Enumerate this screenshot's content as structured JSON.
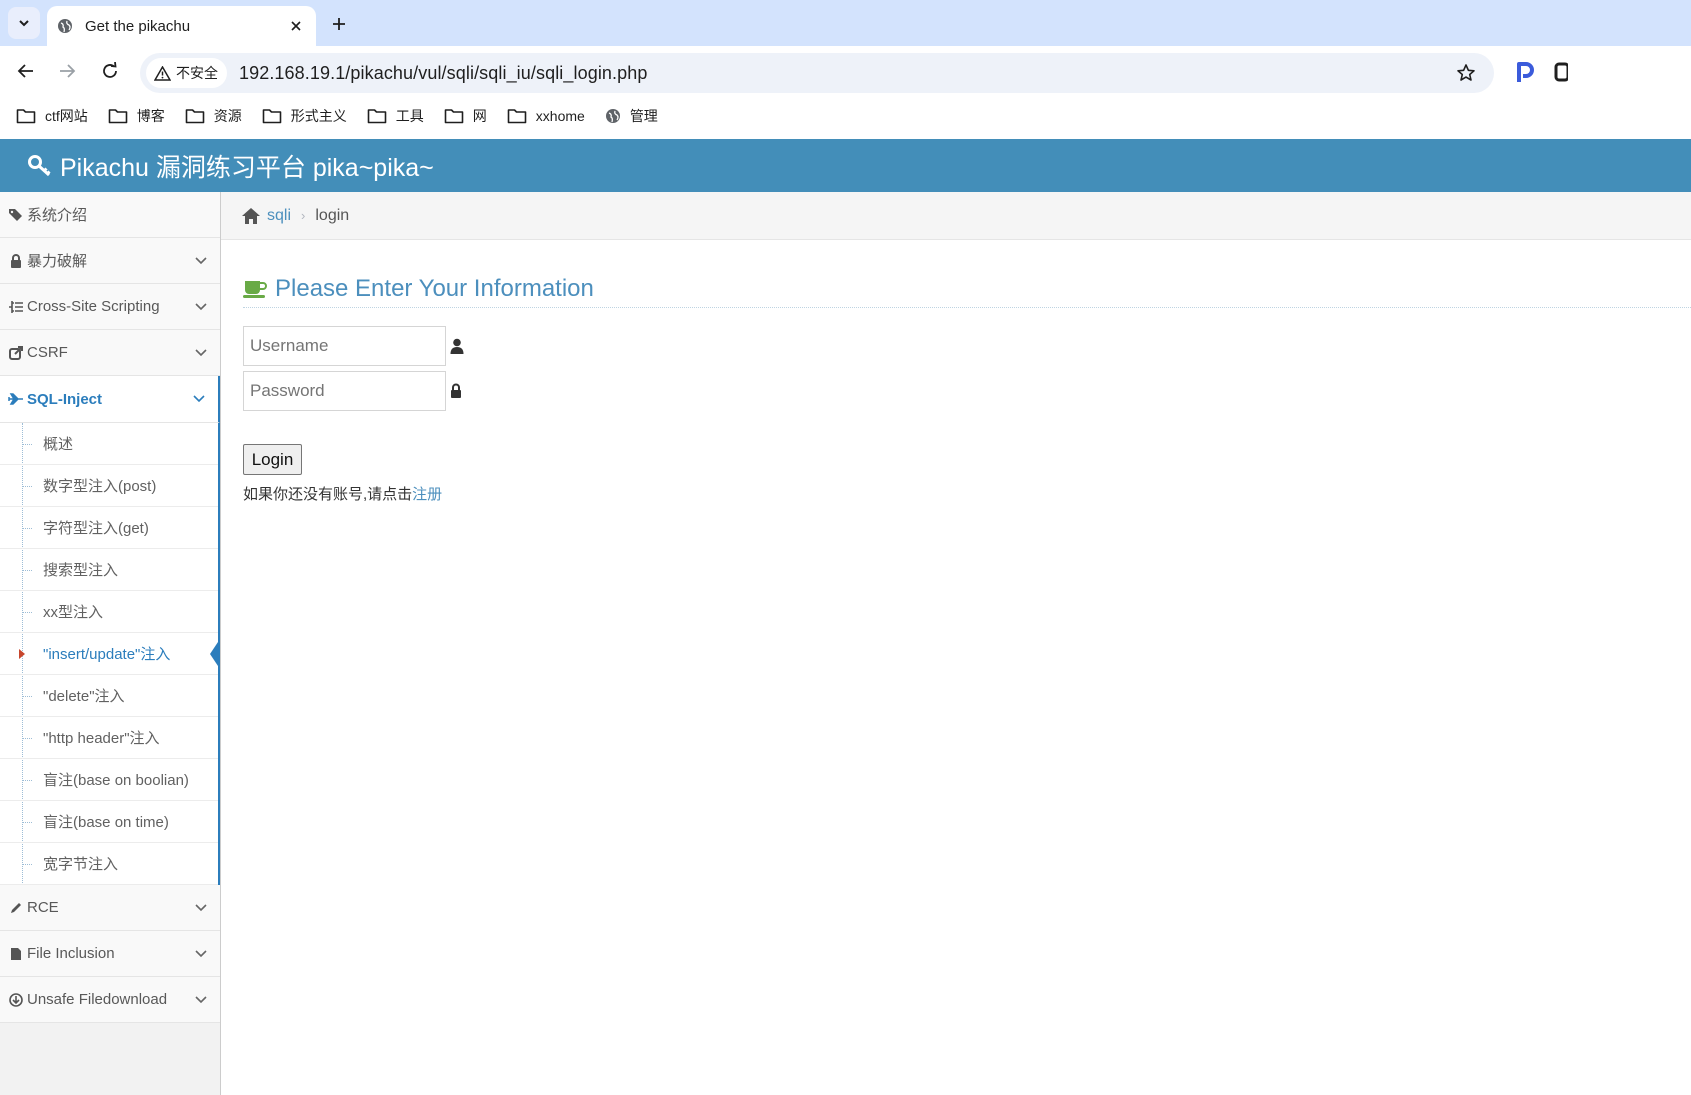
{
  "browser": {
    "tab_title": "Get the pikachu",
    "security_label": "不安全",
    "url": "192.168.19.1/pikachu/vul/sqli/sqli_iu/sqli_login.php",
    "bookmarks": [
      "ctf网站",
      "博客",
      "资源",
      "形式主义",
      "工具",
      "网",
      "xxhome",
      "管理"
    ]
  },
  "navbar": {
    "brand": "Pikachu 漏洞练习平台 pika~pika~"
  },
  "sidebar": {
    "items": [
      {
        "label": "系统介绍",
        "icon": "tags-icon"
      },
      {
        "label": "暴力破解",
        "icon": "lock-icon"
      },
      {
        "label": "Cross-Site Scripting",
        "icon": "list-icon"
      },
      {
        "label": "CSRF",
        "icon": "share-icon"
      },
      {
        "label": "SQL-Inject",
        "icon": "plane-icon"
      },
      {
        "label": "RCE",
        "icon": "pencil-icon"
      },
      {
        "label": "File Inclusion",
        "icon": "file-icon"
      },
      {
        "label": "Unsafe Filedownload",
        "icon": "download-icon"
      }
    ],
    "sqli_sub": [
      "概述",
      "数字型注入(post)",
      "字符型注入(get)",
      "搜索型注入",
      "xx型注入",
      "\"insert/update\"注入",
      "\"delete\"注入",
      "\"http header\"注入",
      "盲注(base on boolian)",
      "盲注(base on time)",
      "宽字节注入"
    ]
  },
  "breadcrumbs": {
    "link": "sqli",
    "current": "login"
  },
  "main": {
    "header": "Please Enter Your Information",
    "username_placeholder": "Username",
    "password_placeholder": "Password",
    "login_label": "Login",
    "register_text": "如果你还没有账号,请点击",
    "register_link": "注册"
  },
  "colors": {
    "navbar": "#438eb9",
    "accent": "#2b7dbc",
    "link": "#4c8fbd",
    "tabstrip": "#d3e3fd"
  }
}
